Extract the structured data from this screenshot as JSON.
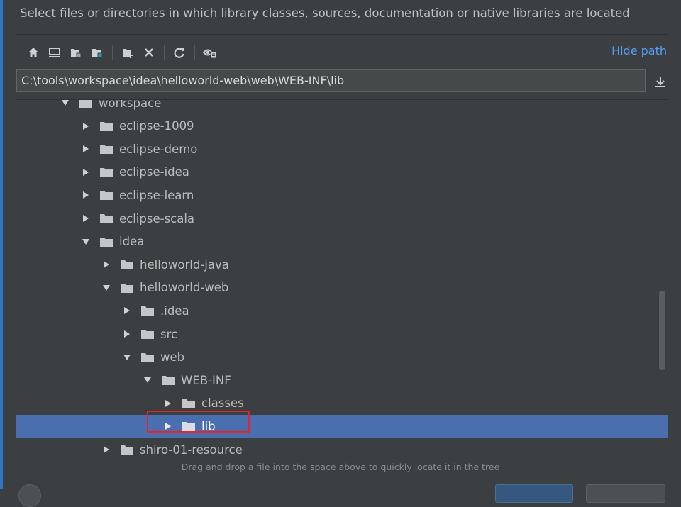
{
  "dialog": {
    "description": "Select files or directories in which library classes, sources, documentation or native libraries are located",
    "hide_path_label": "Hide path",
    "path_value": "C:\\tools\\workspace\\idea\\helloworld-web\\web\\WEB-INF\\lib",
    "drag_hint": "Drag and drop a file into the space above to quickly locate it in the tree"
  },
  "toolbar": {
    "icons": [
      "home-icon",
      "desktop-icon",
      "project-folder-icon",
      "module-folder-icon",
      "new-folder-icon",
      "delete-icon",
      "refresh-icon",
      "show-hidden-icon"
    ]
  },
  "tree": {
    "rows": [
      {
        "label": "workspace",
        "depth": 0,
        "expanded": true
      },
      {
        "label": "eclipse-1009",
        "depth": 1,
        "expanded": false
      },
      {
        "label": "eclipse-demo",
        "depth": 1,
        "expanded": false
      },
      {
        "label": "eclipse-idea",
        "depth": 1,
        "expanded": false
      },
      {
        "label": "eclipse-learn",
        "depth": 1,
        "expanded": false
      },
      {
        "label": "eclipse-scala",
        "depth": 1,
        "expanded": false
      },
      {
        "label": "idea",
        "depth": 1,
        "expanded": true
      },
      {
        "label": "helloworld-java",
        "depth": 2,
        "expanded": false
      },
      {
        "label": "helloworld-web",
        "depth": 2,
        "expanded": true
      },
      {
        "label": ".idea",
        "depth": 3,
        "expanded": false
      },
      {
        "label": "src",
        "depth": 3,
        "expanded": false
      },
      {
        "label": "web",
        "depth": 3,
        "expanded": true
      },
      {
        "label": "WEB-INF",
        "depth": 4,
        "expanded": true
      },
      {
        "label": "classes",
        "depth": 5,
        "expanded": false
      },
      {
        "label": "lib",
        "depth": 5,
        "expanded": false,
        "selected": true
      },
      {
        "label": "shiro-01-resource",
        "depth": 2,
        "expanded": false
      }
    ]
  },
  "colors": {
    "background": "#3c3f41",
    "selection": "#4b6eaf",
    "link": "#589df6",
    "highlight": "#e0252b"
  }
}
